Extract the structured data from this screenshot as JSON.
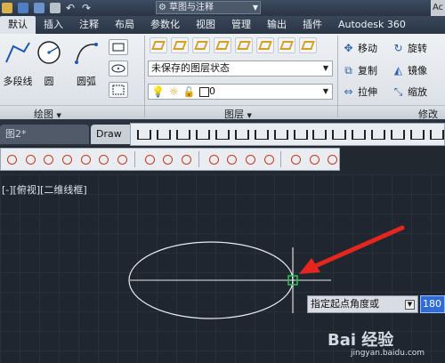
{
  "title_bar": {
    "workspace": "草图与注释",
    "brand_fragment": "Ac"
  },
  "ribbon_tabs": [
    "默认",
    "插入",
    "注释",
    "布局",
    "参数化",
    "视图",
    "管理",
    "输出",
    "插件",
    "Autodesk 360"
  ],
  "draw_panel": {
    "title": "绘图",
    "tools": [
      "多段线",
      "圆",
      "圆弧"
    ]
  },
  "layer_panel": {
    "title": "图层",
    "layer_state": "未保存的图层状态",
    "current_layer": "0"
  },
  "modify_panel": {
    "title": "修改",
    "tools": [
      "移动",
      "旋转",
      "复制",
      "镜像",
      "拉伸",
      "缩放"
    ]
  },
  "doc_tabs": [
    "图2*",
    "Draw"
  ],
  "viewport": {
    "label": "[-][俯视][二维线框]"
  },
  "prompt": {
    "text": "指定起点角度或",
    "value": "180"
  },
  "watermark": {
    "brand": "Bai 经验",
    "url": "jingyan.baidu.com"
  },
  "colors": {
    "canvas": "#1f262f",
    "accent_blue": "#2f6bd9",
    "arrow_red": "#e5261e",
    "snap_green": "#22c24a"
  }
}
